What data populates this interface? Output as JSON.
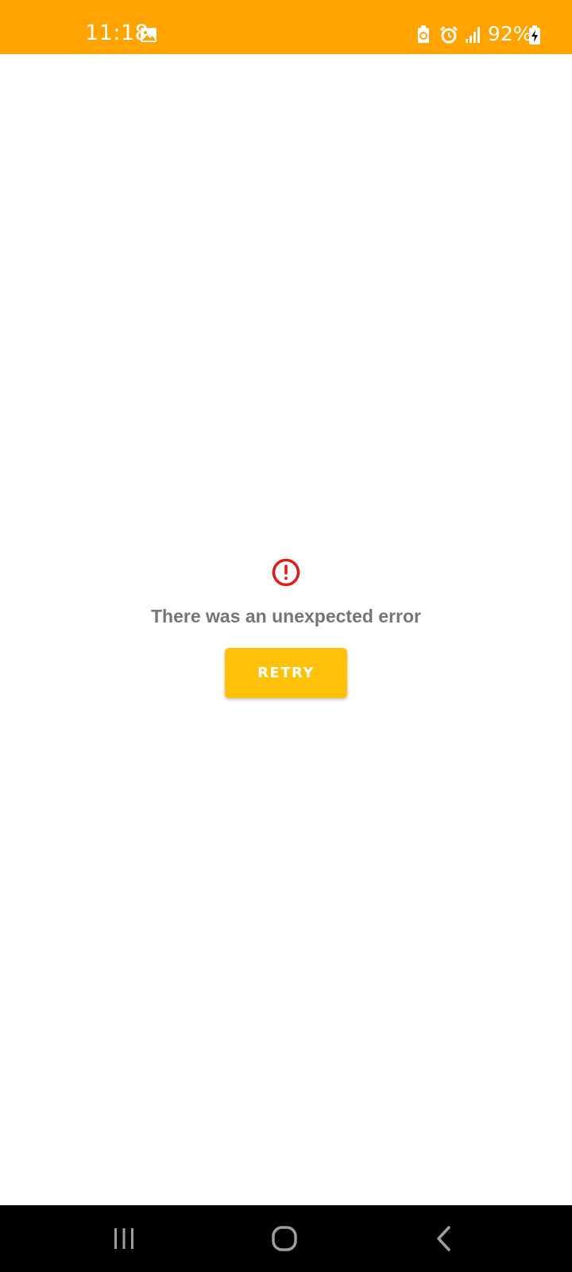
{
  "status_bar": {
    "time": "11:18",
    "battery_percent": "92%",
    "background_color": "#ffa300",
    "icons": [
      "gallery-icon",
      "battery-saver-icon",
      "alarm-icon",
      "signal-icon",
      "charging-battery-icon"
    ]
  },
  "error": {
    "icon": "error-circle-icon",
    "icon_color": "#e31b1b",
    "message": "There was an unexpected error"
  },
  "retry_button": {
    "label": "RETRY",
    "color": "#ffc107"
  },
  "nav_bar": {
    "buttons": [
      "recents-icon",
      "home-icon",
      "back-icon"
    ]
  }
}
